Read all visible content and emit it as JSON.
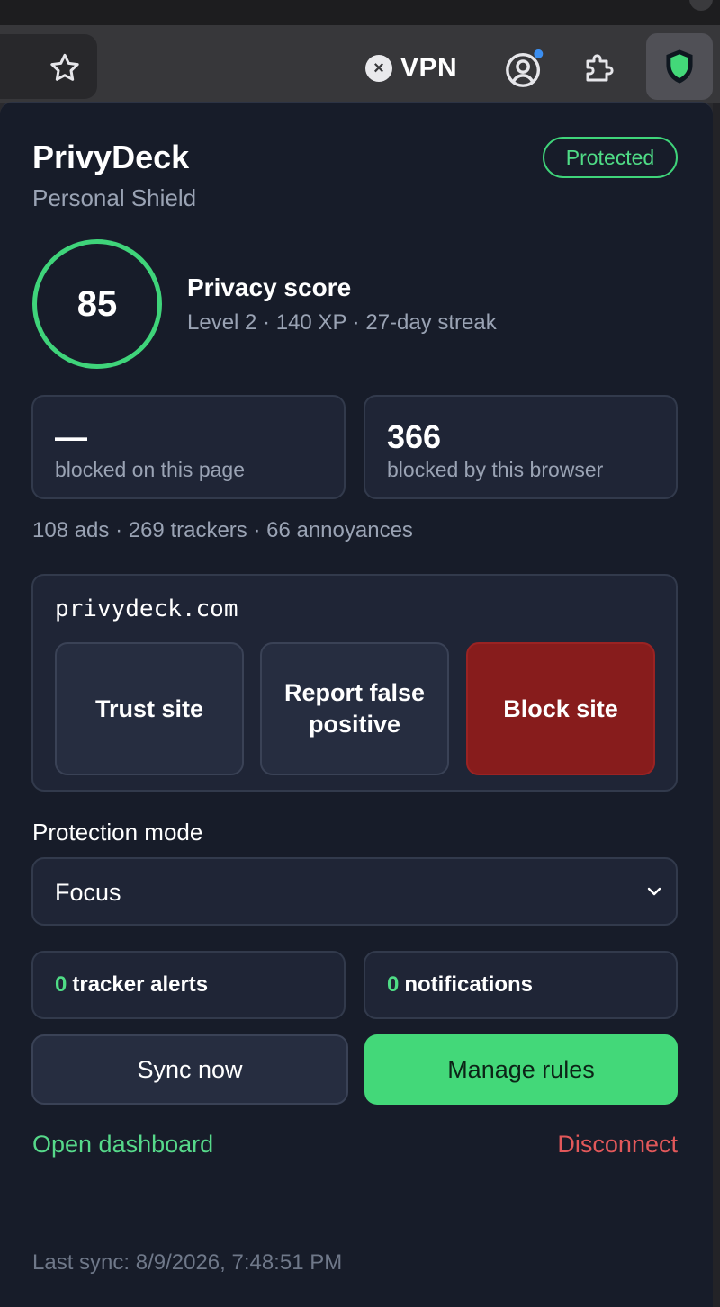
{
  "toolbar": {
    "vpn_label": "VPN",
    "icons": [
      "star-icon",
      "vpn-off-icon",
      "profile-icon",
      "extensions-puzzle-icon",
      "shield-extension-icon"
    ]
  },
  "popup": {
    "app_name": "PrivyDeck",
    "app_subtitle": "Personal Shield",
    "status_badge": "Protected",
    "score": {
      "value": "85",
      "title": "Privacy score",
      "details": "Level 2 · 140 XP · 27-day streak"
    },
    "stats": [
      {
        "value": "—",
        "caption": "blocked on this page"
      },
      {
        "value": "366",
        "caption": "blocked by this browser"
      }
    ],
    "breakdown": "108 ads · 269 trackers · 66 annoyances",
    "site": {
      "domain": "privydeck.com",
      "trust_label": "Trust site",
      "report_label": "Report false positive",
      "block_label": "Block site"
    },
    "mode": {
      "label": "Protection mode",
      "selected": "Focus"
    },
    "alerts": [
      {
        "count": "0",
        "label": "tracker alerts"
      },
      {
        "count": "0",
        "label": "notifications"
      }
    ],
    "actions": {
      "sync_label": "Sync now",
      "manage_label": "Manage rules"
    },
    "links": {
      "open_dashboard": "Open dashboard",
      "disconnect": "Disconnect"
    },
    "last_sync": "Last sync: 8/9/2026, 7:48:51 PM"
  },
  "colors": {
    "accent_green": "#43d879",
    "danger_red": "#871c1c",
    "popup_bg": "#171c29",
    "card_bg": "#1f2536",
    "disconnect_red": "#e2585a"
  }
}
